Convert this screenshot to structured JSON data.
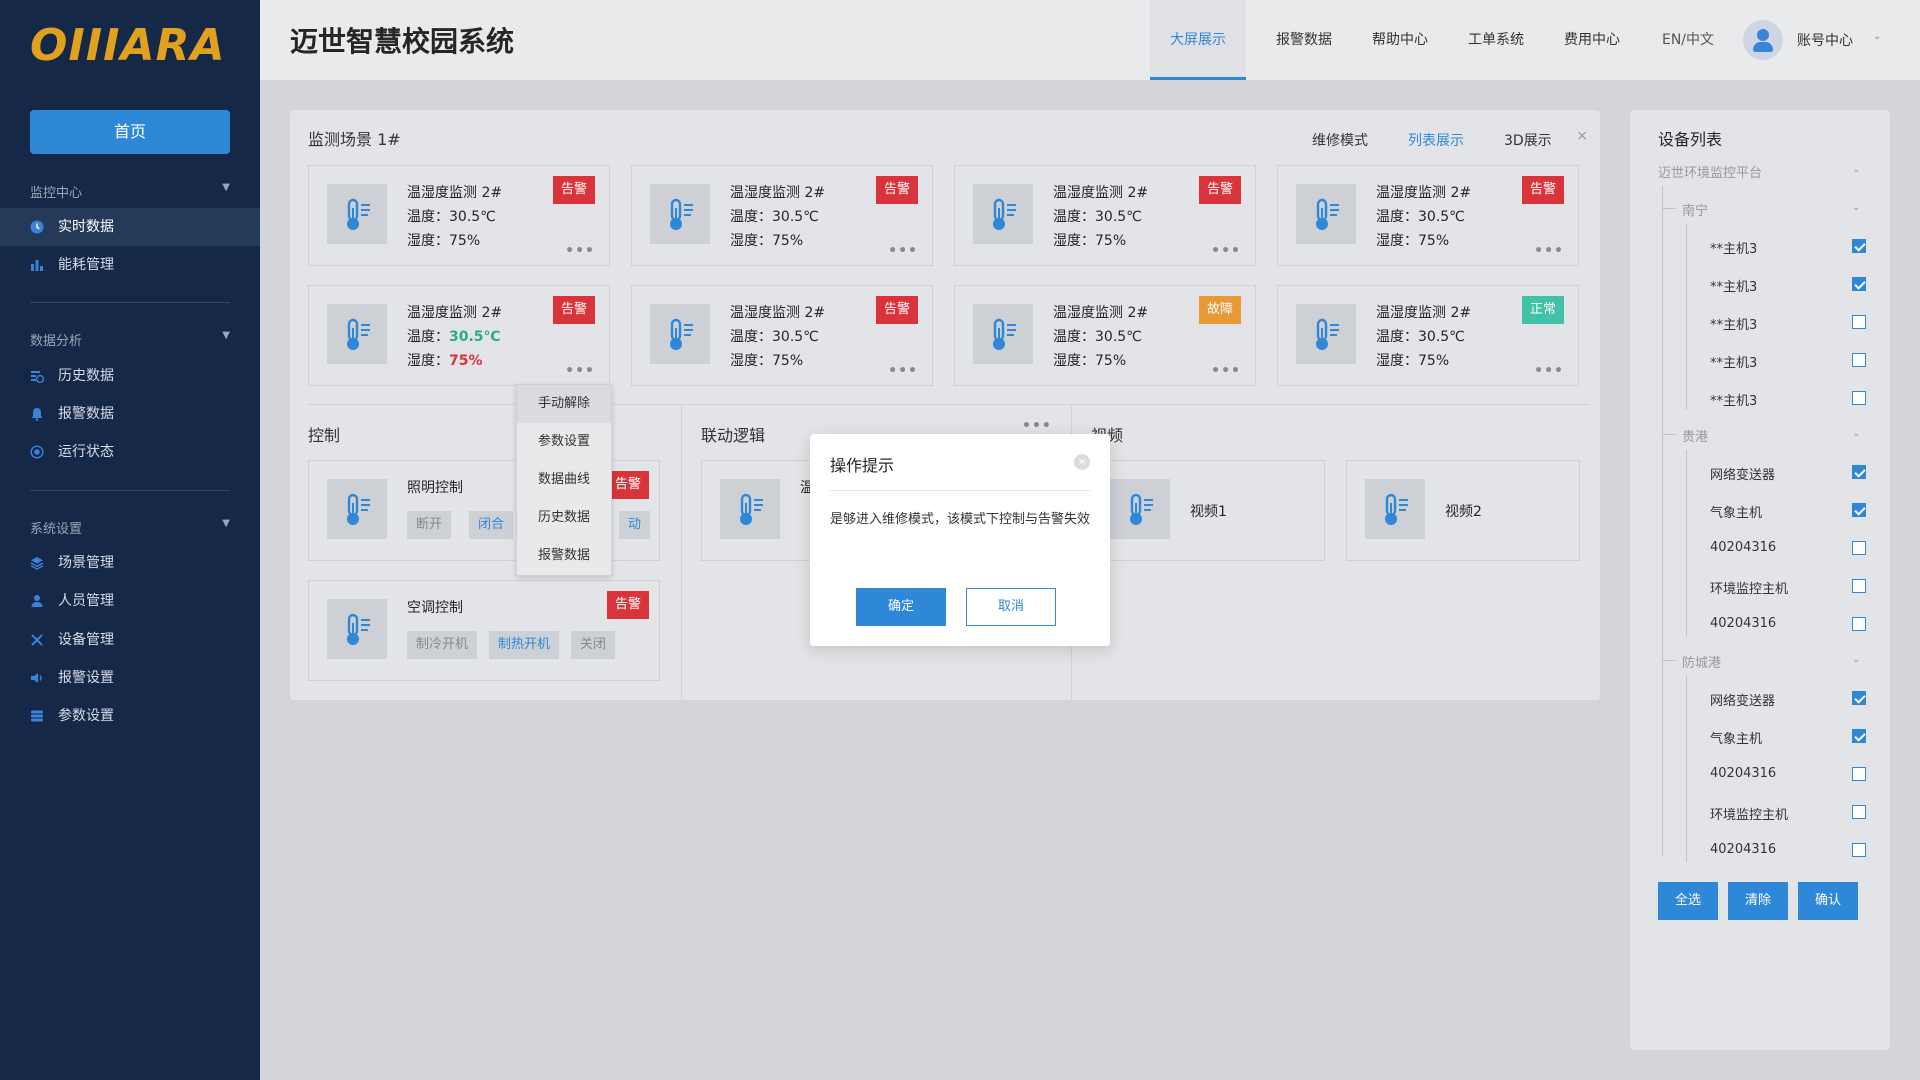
{
  "brand": {
    "logo": "OIIIARA"
  },
  "sidebar": {
    "home": "首页",
    "groups": [
      {
        "title": "监控中心",
        "items": [
          {
            "label": "实时数据",
            "icon": "clock-icon",
            "active": true
          },
          {
            "label": "能耗管理",
            "icon": "bar-chart-icon"
          }
        ]
      },
      {
        "title": "数据分析",
        "items": [
          {
            "label": "历史数据",
            "icon": "history-icon"
          },
          {
            "label": "报警数据",
            "icon": "bell-icon"
          },
          {
            "label": "运行状态",
            "icon": "status-icon"
          }
        ]
      },
      {
        "title": "系统设置",
        "items": [
          {
            "label": "场景管理",
            "icon": "layers-icon"
          },
          {
            "label": "人员管理",
            "icon": "user-icon"
          },
          {
            "label": "设备管理",
            "icon": "tools-icon"
          },
          {
            "label": "报警设置",
            "icon": "speaker-icon"
          },
          {
            "label": "参数设置",
            "icon": "database-icon"
          }
        ]
      }
    ]
  },
  "header": {
    "title": "迈世智慧校园系统",
    "nav": [
      "大屏展示",
      "报警数据",
      "帮助中心",
      "工单系统",
      "费用中心",
      "EN/中文"
    ],
    "account": "账号中心"
  },
  "scene": {
    "title": "监测场景 1#",
    "modes": [
      "维修模式",
      "列表展示",
      "3D展示"
    ],
    "close": "×",
    "cards": [
      {
        "name": "温湿度监测 2#",
        "temp_label": "温度：",
        "temp": "30.5℃",
        "hum_label": "湿度：",
        "hum": "75%",
        "status": "告警",
        "status_color": "#d9343b"
      },
      {
        "name": "温湿度监测 2#",
        "temp_label": "温度：",
        "temp": "30.5℃",
        "hum_label": "湿度：",
        "hum": "75%",
        "status": "告警",
        "status_color": "#d9343b"
      },
      {
        "name": "温湿度监测 2#",
        "temp_label": "温度：",
        "temp": "30.5℃",
        "hum_label": "湿度：",
        "hum": "75%",
        "status": "告警",
        "status_color": "#d9343b"
      },
      {
        "name": "温湿度监测 2#",
        "temp_label": "温度：",
        "temp": "30.5℃",
        "hum_label": "湿度：",
        "hum": "75%",
        "status": "告警",
        "status_color": "#d9343b"
      },
      {
        "name": "温湿度监测 2#",
        "temp_label": "温度：",
        "temp": "30.5℃",
        "hum_label": "湿度：",
        "hum": "75%",
        "status": "告警",
        "status_color": "#d9343b"
      },
      {
        "name": "温湿度监测 2#",
        "temp_label": "温度：",
        "temp": "30.5℃",
        "hum_label": "湿度：",
        "hum": "75%",
        "status": "告警",
        "status_color": "#d9343b"
      },
      {
        "name": "温湿度监测 2#",
        "temp_label": "温度：",
        "temp": "30.5℃",
        "hum_label": "湿度：",
        "hum": "75%",
        "status": "故障",
        "status_color": "#e89a36"
      },
      {
        "name": "温湿度监测 2#",
        "temp_label": "温度：",
        "temp": "30.5℃",
        "hum_label": "湿度：",
        "hum": "75%",
        "status": "正常",
        "status_color": "#41c2a8"
      }
    ],
    "more": "•••"
  },
  "dropdown": [
    "手动解除",
    "参数设置",
    "数据曲线",
    "历史数据",
    "报警数据"
  ],
  "control": {
    "title": "控制",
    "lighting": {
      "name": "照明控制",
      "status": "告警",
      "buttons": [
        "断开",
        "闭合",
        "动"
      ]
    },
    "ac": {
      "name": "空调控制",
      "status": "告警",
      "buttons": [
        "制冷开机",
        "制热开机",
        "关闭"
      ]
    }
  },
  "linkage": {
    "title": "联动逻辑",
    "card_partial": "温",
    "more": "•••"
  },
  "video": {
    "title": "视频",
    "items": [
      "视频1",
      "视频2"
    ]
  },
  "modal": {
    "title": "操作提示",
    "body": "是够进入维修模式，该模式下控制与告警失效",
    "ok": "确定",
    "cancel": "取消",
    "close": "×"
  },
  "device_list": {
    "title": "设备列表",
    "root": "迈世环境监控平台",
    "groups": [
      {
        "name": "南宁",
        "items": [
          {
            "label": "**主机3",
            "checked": true
          },
          {
            "label": "**主机3",
            "checked": true
          },
          {
            "label": "**主机3",
            "checked": false
          },
          {
            "label": "**主机3",
            "checked": false
          },
          {
            "label": "**主机3",
            "checked": false
          }
        ]
      },
      {
        "name": "贵港",
        "items": [
          {
            "label": "网络变送器",
            "checked": true
          },
          {
            "label": "气象主机",
            "checked": true
          },
          {
            "label": "40204316",
            "checked": false
          },
          {
            "label": "环境监控主机",
            "checked": false
          },
          {
            "label": "40204316",
            "checked": false
          }
        ]
      },
      {
        "name": "防城港",
        "items": [
          {
            "label": "网络变送器",
            "checked": true
          },
          {
            "label": "气象主机",
            "checked": true
          },
          {
            "label": "40204316",
            "checked": false
          },
          {
            "label": "环境监控主机",
            "checked": false
          },
          {
            "label": "40204316",
            "checked": false
          }
        ]
      }
    ],
    "buttons": [
      "全选",
      "清除",
      "确认"
    ]
  },
  "colors": {
    "accent": "#2f87d8",
    "sidebar_bg": "#152848",
    "alarm": "#d9343b",
    "fault": "#e89a36",
    "normal": "#41c2a8"
  }
}
